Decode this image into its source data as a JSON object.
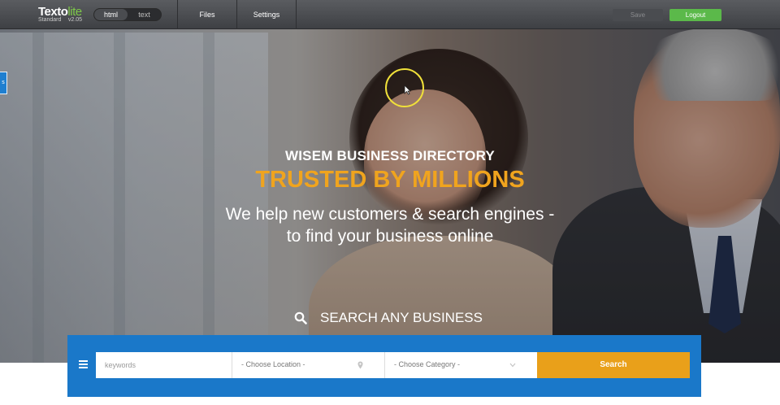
{
  "toolbar": {
    "logo_main": "Texto",
    "logo_accent": "lite",
    "logo_edition": "Standard",
    "logo_version": "v2.05",
    "mode_html": "html",
    "mode_text": "text",
    "active_mode": "html",
    "tab_files": "Files",
    "tab_settings": "Settings",
    "save_label": "Save",
    "logout_label": "Logout"
  },
  "side_tab": {
    "label": "s"
  },
  "hero": {
    "eyebrow": "WISEM BUSINESS DIRECTORY",
    "headline": "TRUSTED BY MILLIONS",
    "tagline_line1": "We help new customers & search engines -",
    "tagline_line2": "to find your business online",
    "search_title": "SEARCH ANY BUSINESS"
  },
  "search": {
    "keywords_placeholder": "keywords",
    "location_label": "- Choose Location -",
    "category_label": "- Choose Category -",
    "button_label": "Search"
  },
  "colors": {
    "accent_orange": "#e9a01a",
    "headline_orange": "#f0a41e",
    "search_bar_blue": "#1a78c9",
    "logout_green": "#5bb94a"
  },
  "icons": {
    "search_title_icon": "search-icon",
    "menu_icon": "hamburger-menu-icon",
    "location_icon": "map-pin-icon",
    "category_icon": "chevron-down-icon"
  }
}
